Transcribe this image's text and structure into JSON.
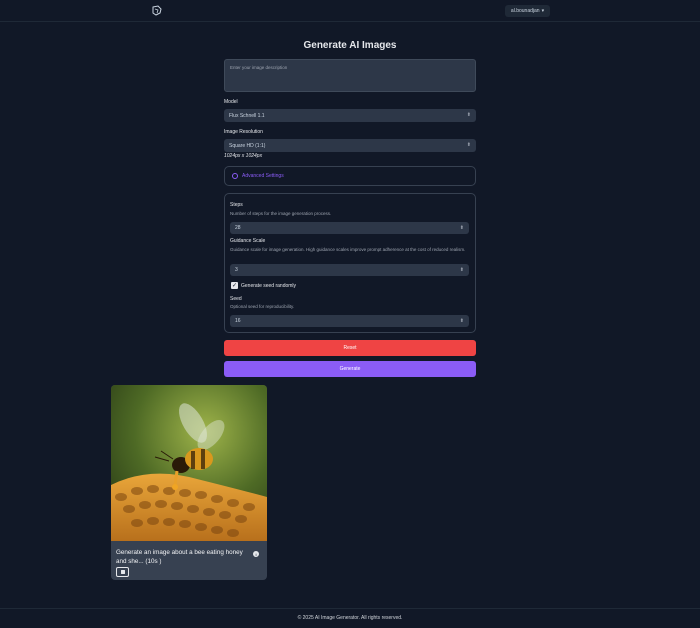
{
  "header": {
    "logo_icon": "brain-logo-icon",
    "user_button": "al.bounadjan",
    "user_chevron": "▾"
  },
  "form": {
    "title": "Generate AI Images",
    "prompt_placeholder": "Enter your image description",
    "model_label": "Model",
    "model_value": "Flux Schnell 1.1",
    "resolution_label": "Image Resolution",
    "resolution_value": "Square HD (1:1)",
    "resolution_note": "1024px x 1024px",
    "advanced_label": "Advanced Settings",
    "steps_label": "Steps",
    "steps_desc": "Number of steps for the image generation process.",
    "steps_value": "28",
    "guidance_label": "Guidance Scale",
    "guidance_desc": "Guidance scale for image generation. High guidance scales improve prompt adherence at the cost of reduced realism.",
    "guidance_value": "3",
    "random_seed_label": "Generate seed randomly",
    "random_seed_checked": true,
    "seed_label": "Seed",
    "seed_desc": "Optional seed for reproducibility.",
    "seed_value": "16",
    "reset_button": "Reset",
    "generate_button": "Generate"
  },
  "result_card": {
    "caption": "Generate an image about a bee eating honey and she... (10s )",
    "info_icon": "info-icon",
    "stop_icon": "stop-icon"
  },
  "footer": {
    "text": "© 2025 AI Image Generator. All rights reserved."
  },
  "colors": {
    "background": "#111827",
    "input": "#2d3748",
    "accent": "#8b5cf6",
    "danger": "#ef4444"
  }
}
